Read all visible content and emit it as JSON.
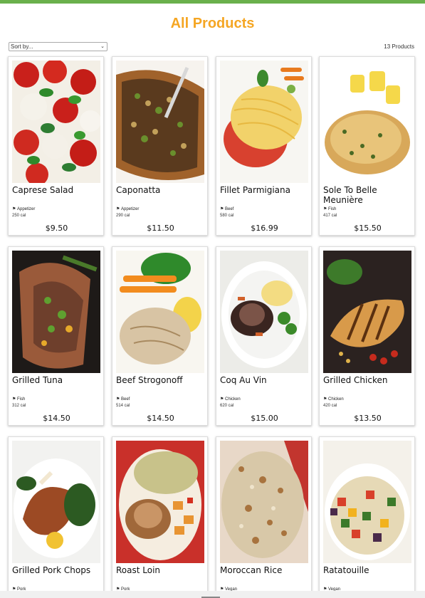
{
  "header": {
    "title": "All Products"
  },
  "toolbar": {
    "sort_label": "Sort by...",
    "product_count": "13 Products"
  },
  "colors": {
    "accent": "#f5a623",
    "top_bar": "#6ab04c"
  },
  "products": [
    {
      "name": "Caprese Salad",
      "category": "Appetizer",
      "calories": "250 cal",
      "price": "$9.50",
      "image": "caprese-salad-photo"
    },
    {
      "name": "Caponatta",
      "category": "Appetizer",
      "calories": "290 cal",
      "price": "$11.50",
      "image": "caponatta-photo"
    },
    {
      "name": "Fillet Parmigiana",
      "category": "Beef",
      "calories": "580 cal",
      "price": "$16.99",
      "image": "fillet-parmigiana-photo"
    },
    {
      "name": "Sole To Belle Meunière",
      "category": "Fish",
      "calories": "417 cal",
      "price": "$15.50",
      "image": "sole-meuniere-photo"
    },
    {
      "name": "Grilled Tuna",
      "category": "Fish",
      "calories": "312 cal",
      "price": "$14.50",
      "image": "grilled-tuna-photo"
    },
    {
      "name": "Beef Strogonoff",
      "category": "Beef",
      "calories": "514 cal",
      "price": "$14.50",
      "image": "beef-strogonoff-photo"
    },
    {
      "name": "Coq Au Vin",
      "category": "Chicken",
      "calories": "620 cal",
      "price": "$15.00",
      "image": "coq-au-vin-photo"
    },
    {
      "name": "Grilled Chicken",
      "category": "Chicken",
      "calories": "420 cal",
      "price": "$13.50",
      "image": "grilled-chicken-photo"
    },
    {
      "name": "Grilled Pork Chops",
      "category": "Pork",
      "image": "grilled-pork-chops-photo"
    },
    {
      "name": "Roast Loin",
      "category": "Pork",
      "image": "roast-loin-photo"
    },
    {
      "name": "Moroccan Rice",
      "category": "Vegan",
      "image": "moroccan-rice-photo"
    },
    {
      "name": "Ratatouille",
      "category": "Vegan",
      "image": "ratatouille-photo"
    }
  ]
}
